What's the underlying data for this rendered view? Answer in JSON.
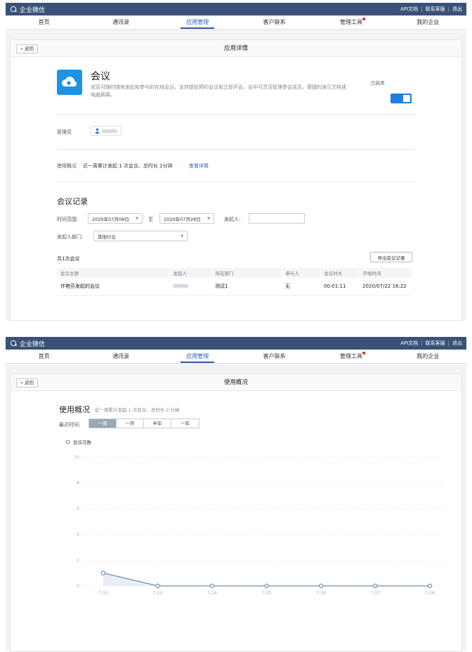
{
  "brand": {
    "name": "企业微信"
  },
  "toplinks": [
    "API文档",
    "联系客服",
    "退出"
  ],
  "nav": [
    {
      "label": "首页",
      "active": false,
      "dot": false
    },
    {
      "label": "通讯录",
      "active": false,
      "dot": false
    },
    {
      "label": "应用管理",
      "active": true,
      "dot": false
    },
    {
      "label": "客户联系",
      "active": false,
      "dot": false
    },
    {
      "label": "管理工具",
      "active": false,
      "dot": true
    },
    {
      "label": "我的企业",
      "active": false,
      "dot": false
    }
  ],
  "panel1": {
    "back_label": "« 返回",
    "title": "应用详情",
    "app": {
      "name": "会议",
      "description": "成员可随时随地发起和参与的在线会议，支持提前预约会议和立即开会，会中可灵活管理参会成员，便捷的演示文档或电脑屏幕。",
      "status_label": "已启用",
      "enabled": true
    },
    "admin_label": "管理员",
    "usage": {
      "label": "使用概况",
      "text": "近一周累计发起 1 次会议、总时长 2分钟",
      "link": "查看详情"
    },
    "records": {
      "title": "会议记录",
      "range_label": "时间范围:",
      "start_date": "2020年07月08日",
      "to": "至",
      "end_date": "2020年07月28日",
      "initiator_label": "发起人:",
      "initiator_value": "",
      "dept_label": "发起人部门:",
      "dept_value": "其他行业",
      "count_text": "共1次会议",
      "export_label": "导出会议记录",
      "columns": [
        "会议主题",
        "发起人",
        "所在部门",
        "参与人",
        "会议时长",
        "开始时间"
      ],
      "rows": [
        [
          "许艳芬发起的会议",
          "",
          "测试1",
          "无",
          "00:01:11",
          "2020/07/22 16:22"
        ]
      ]
    }
  },
  "panel2": {
    "back_label": "« 返回",
    "title": "使用概况",
    "heading": "使用概况",
    "subtitle": "近一周累计发起 1 次会议、总时长 2 分钟",
    "period_label": "最近时间:",
    "periods": [
      "一周",
      "一月",
      "半年",
      "一年"
    ],
    "active_period": 0
  },
  "chart_data": {
    "type": "line",
    "x": [
      "7-22",
      "7-23",
      "7-24",
      "7-25",
      "7-26",
      "7-27",
      "7-28"
    ],
    "series": [
      {
        "name": "会议次数",
        "values": [
          1,
          0,
          0,
          0,
          0,
          0,
          0
        ]
      }
    ],
    "yticks": [
      0,
      2,
      4,
      6,
      8,
      10
    ],
    "ylim": [
      0,
      10
    ],
    "grid": true,
    "legend": "top-left",
    "color": "#6f8bb0"
  }
}
